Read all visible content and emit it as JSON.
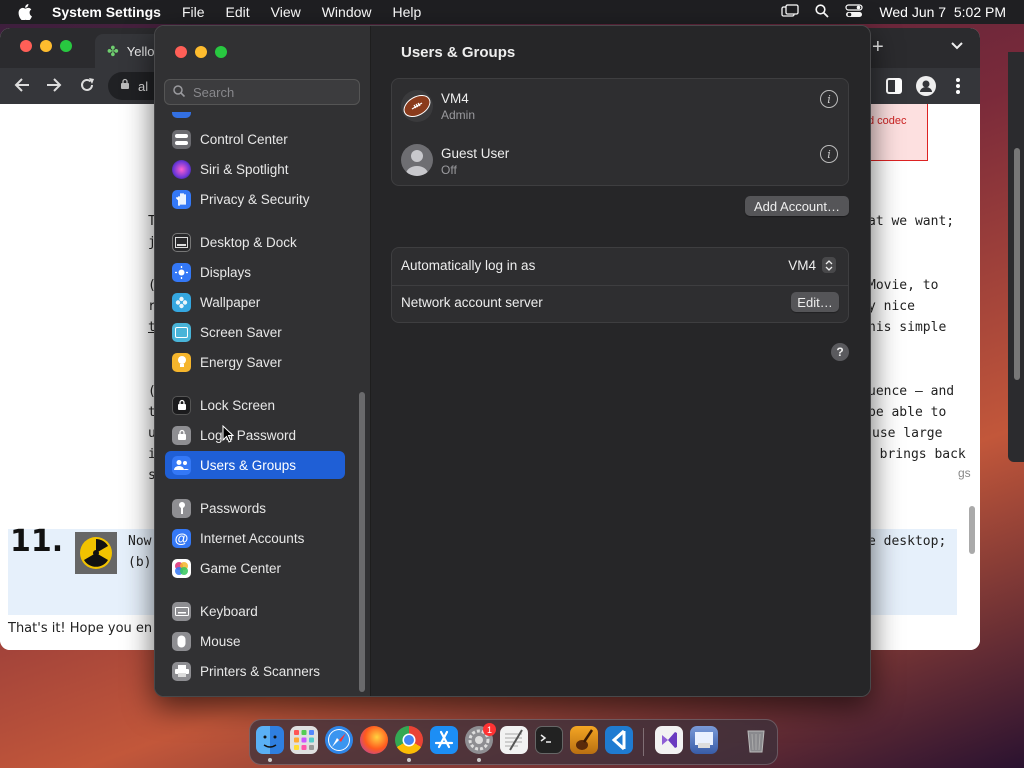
{
  "menubar": {
    "app": "System Settings",
    "items": [
      "File",
      "Edit",
      "View",
      "Window",
      "Help"
    ],
    "clock": "Wed Jun 7  5:02 PM"
  },
  "browser": {
    "tab_title": "Yello",
    "address": "al",
    "text_lines": [
      {
        "t": "d codec"
      },
      {
        "t": "T"
      },
      {
        "t": "at we want;"
      },
      {
        "t": "j"
      },
      {
        "t": "("
      },
      {
        "t": "Movie, to"
      },
      {
        "t": "r"
      },
      {
        "t": "y nice"
      },
      {
        "t": "t"
      },
      {
        "t": "his simple"
      },
      {
        "t": "("
      },
      {
        "t": "uence — and"
      },
      {
        "t": "t"
      },
      {
        "t": "be able to"
      },
      {
        "t": "u"
      },
      {
        "t": "use large"
      },
      {
        "t": "i"
      },
      {
        "t": "I brings back"
      },
      {
        "t": "s"
      },
      {
        "t": "gs"
      }
    ],
    "step_number": "11.",
    "step_text_a": "Now",
    "step_text_b": "(b)",
    "step_text_right": "e desktop;",
    "footer_text": "That's it! Hope you en"
  },
  "settings": {
    "search_placeholder": "Search",
    "sidebar_items": [
      {
        "label": "Control Center",
        "color": "#6b6b70"
      },
      {
        "label": "Siri & Spotlight",
        "color": "#b73cc8"
      },
      {
        "label": "Privacy & Security",
        "color": "#3478f6"
      },
      {
        "label": "Desktop & Dock",
        "color": "#2a2a2c"
      },
      {
        "label": "Displays",
        "color": "#3478f6"
      },
      {
        "label": "Wallpaper",
        "color": "#35a7e0"
      },
      {
        "label": "Screen Saver",
        "color": "#49b4d8"
      },
      {
        "label": "Energy Saver",
        "color": "#f5b52c"
      },
      {
        "label": "Lock Screen",
        "color": "#1b1b1d"
      },
      {
        "label": "Login Password",
        "color": "#8e8e92"
      },
      {
        "label": "Users & Groups",
        "color": "#3478f6"
      },
      {
        "label": "Passwords",
        "color": "#8e8e92"
      },
      {
        "label": "Internet Accounts",
        "color": "#3478f6"
      },
      {
        "label": "Game Center",
        "color": "#e04a8a"
      },
      {
        "label": "Keyboard",
        "color": "#8e8e92"
      },
      {
        "label": "Mouse",
        "color": "#8e8e92"
      },
      {
        "label": "Printers & Scanners",
        "color": "#8e8e92"
      }
    ],
    "selected": "Users & Groups",
    "title": "Users & Groups",
    "users": [
      {
        "name": "VM4",
        "role": "Admin"
      },
      {
        "name": "Guest User",
        "role": "Off"
      }
    ],
    "add_account_label": "Add Account…",
    "auto_login_label": "Automatically log in as",
    "auto_login_value": "VM4",
    "network_server_label": "Network account server",
    "edit_label": "Edit…",
    "help_label": "?"
  },
  "dock": {
    "apps": [
      {
        "name": "finder-icon",
        "color": "#3f9cf0"
      },
      {
        "name": "launchpad-icon",
        "color": "#d9d9d9"
      },
      {
        "name": "safari-icon",
        "color": "#2f86e8"
      },
      {
        "name": "firefox-icon",
        "color": "#ff7a1e"
      },
      {
        "name": "chrome-icon",
        "color": "#e8e8e8"
      },
      {
        "name": "app-store-icon",
        "color": "#1c8ef5"
      },
      {
        "name": "system-settings-icon",
        "color": "#8e8e92"
      },
      {
        "name": "textedit-icon",
        "color": "#f2f2f2"
      },
      {
        "name": "terminal-icon",
        "color": "#222"
      },
      {
        "name": "garageband-icon",
        "color": "#e09030"
      },
      {
        "name": "vscode-icon",
        "color": "#1f7bd1"
      },
      {
        "name": "visual-studio-icon",
        "color": "#8f5fd6"
      },
      {
        "name": "preview-icon",
        "color": "#5a80c8"
      },
      {
        "name": "trash-icon",
        "color": "#7a7a7e"
      }
    ],
    "badge": "1"
  }
}
